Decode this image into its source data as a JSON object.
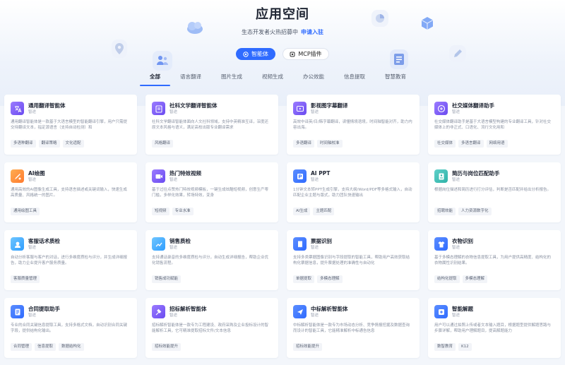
{
  "header": {
    "title": "应用空间",
    "subtitle": "生态开发者火热招募中",
    "cta_link": "申请入驻",
    "toggle_active": "智能体",
    "toggle_inactive": "MCP插件"
  },
  "tabs": [
    {
      "label": "全部",
      "active": true
    },
    {
      "label": "语言翻译",
      "active": false
    },
    {
      "label": "图片生成",
      "active": false
    },
    {
      "label": "视频生成",
      "active": false
    },
    {
      "label": "办公效能",
      "active": false
    },
    {
      "label": "信息提取",
      "active": false
    },
    {
      "label": "智慧教育",
      "active": false
    }
  ],
  "cards": [
    {
      "title": "通用翻译智能体",
      "tag": "智途",
      "desc": "通用翻译智能体是一款基于大语言模型的智能翻译引擎，用户只需提交待翻译文本，指定源语言（支持自动检测）和",
      "chips": [
        "多语种翻译",
        "翻译策略",
        "文化适配"
      ],
      "icon": "translate-icon",
      "color": "c-purple"
    },
    {
      "title": "社科文学翻译智能体",
      "tag": "智途",
      "desc": "社科文学翻译智能体面向人文社科领域，支持中英精准互译，深度还原文本风格与语义，满足高校出版专业翻译需求",
      "chips": [
        "风格翻译"
      ],
      "icon": "book-icon",
      "color": "c-purple"
    },
    {
      "title": "影视图字幕翻译",
      "tag": "智途",
      "desc": "高效中译英/日/韩字幕翻译，读懂情境语境，时间轴智能对齐，助力内容出海。",
      "chips": [
        "多语翻译",
        "时间轴校准"
      ],
      "icon": "subtitle-icon",
      "color": "c-purple"
    },
    {
      "title": "社交媒体翻译助手",
      "tag": "智途",
      "desc": "社交媒体翻译助手是基于大语言模型构建的专业翻译工具，针对社交媒体上的非正式、口语化、流行文化用和",
      "chips": [
        "社交媒体",
        "多语言翻译",
        "网络用语"
      ],
      "icon": "social-icon",
      "color": "c-purple"
    },
    {
      "title": "AI绘图",
      "tag": "智途",
      "desc": "通用高效的AI图像生成工具，支持语言描述或关键词输入，快速生成高质量、风格统一的图片。",
      "chips": [
        "通用绘图工具"
      ],
      "icon": "paint-icon",
      "color": "c-orange"
    },
    {
      "title": "热门特效视频",
      "tag": "智途",
      "desc": "基于过往点赞热门特效视频模板，一键生成炫酷短视频，创意生产零门槛，多样化效果，转场特效，变身",
      "chips": [
        "短视频",
        "专业水准"
      ],
      "icon": "video-icon",
      "color": "c-purple"
    },
    {
      "title": "AI PPT",
      "tag": "智途",
      "desc": "1分钟文本转PPT生成引擎，支持大纲/Word/PDF等多格式输入，自动匹配企业主题与版式，助力团队快速输出",
      "chips": [
        "AI生成",
        "主题匹配"
      ],
      "icon": "ppt-icon",
      "color": "c-blue"
    },
    {
      "title": "简历与岗位匹配助手",
      "tag": "智途",
      "desc": "根据岗位描述和简历进行打分评估，判断是否匹配并给出分析报告。",
      "chips": [
        "招聘效能",
        "人力资源数字化"
      ],
      "icon": "resume-icon",
      "color": "c-teal"
    },
    {
      "title": "客服话术质检",
      "tag": "智途",
      "desc": "自动分析客服与客户的对话，进行多维度质检与评分，并生成详细报告，助力企业提升客户服务质量。",
      "chips": [
        "客服质量管理"
      ],
      "icon": "service-icon",
      "color": "c-cyan"
    },
    {
      "title": "销售质检",
      "tag": "智途",
      "desc": "支持通话录音的多维度质检与评分，自动生成详细报告，帮助企业优化销售流程。",
      "chips": [
        "销售成功赋能"
      ],
      "icon": "sales-icon",
      "color": "c-cyan"
    },
    {
      "title": "票据识别",
      "tag": "智途",
      "desc": "支持多类票据图像识别与字段提取的智能工具，帮助用户高效获取结构化票据信息，提升票据处理的准确性与自动化",
      "chips": [
        "单据提取",
        "多模态理解"
      ],
      "icon": "receipt-icon",
      "color": "c-blue"
    },
    {
      "title": "衣物识别",
      "tag": "智途",
      "desc": "基于多模态理解的衣物信息提取工具，为用户提供高精度、结构化的衣物属性识别结果。",
      "chips": [
        "结构化提取",
        "多模态理解"
      ],
      "icon": "clothes-icon",
      "color": "c-blue"
    },
    {
      "title": "合同提取助手",
      "tag": "智途",
      "desc": "专业的合同关键信息提取工具，支持多格式文档，自动识别合同关键字段，提供结构化输出。",
      "chips": [
        "合同管理",
        "信息提取",
        "数据结构化"
      ],
      "icon": "contract-icon",
      "color": "c-blue"
    },
    {
      "title": "招标解析智能体",
      "tag": "智途",
      "desc": "招标解析智能体是一款专为工程建设、政府采购及企业投标设计的智能解析工具，它可精准提取招标文件/文本信息",
      "chips": [
        "招标效能提升"
      ],
      "icon": "bid-icon",
      "color": "c-purple"
    },
    {
      "title": "中标解析智能体",
      "tag": "智途",
      "desc": "中标解析智能体是一款专为市场动态分析、竞争情报挖掘及数据查询而设计的智能工具，它能精准解析中标通告信息",
      "chips": [
        "招标效能提升"
      ],
      "icon": "winbid-icon",
      "color": "c-blue"
    },
    {
      "title": "智能解题",
      "tag": "智途",
      "desc": "用户可以通过拍照上传或者文本输入题目，根据题型提供解题思路与步骤详解，帮助用户理解题目，提高解题能力",
      "chips": [
        "数智教育",
        "K12"
      ],
      "icon": "solve-icon",
      "color": "c-blue"
    }
  ]
}
